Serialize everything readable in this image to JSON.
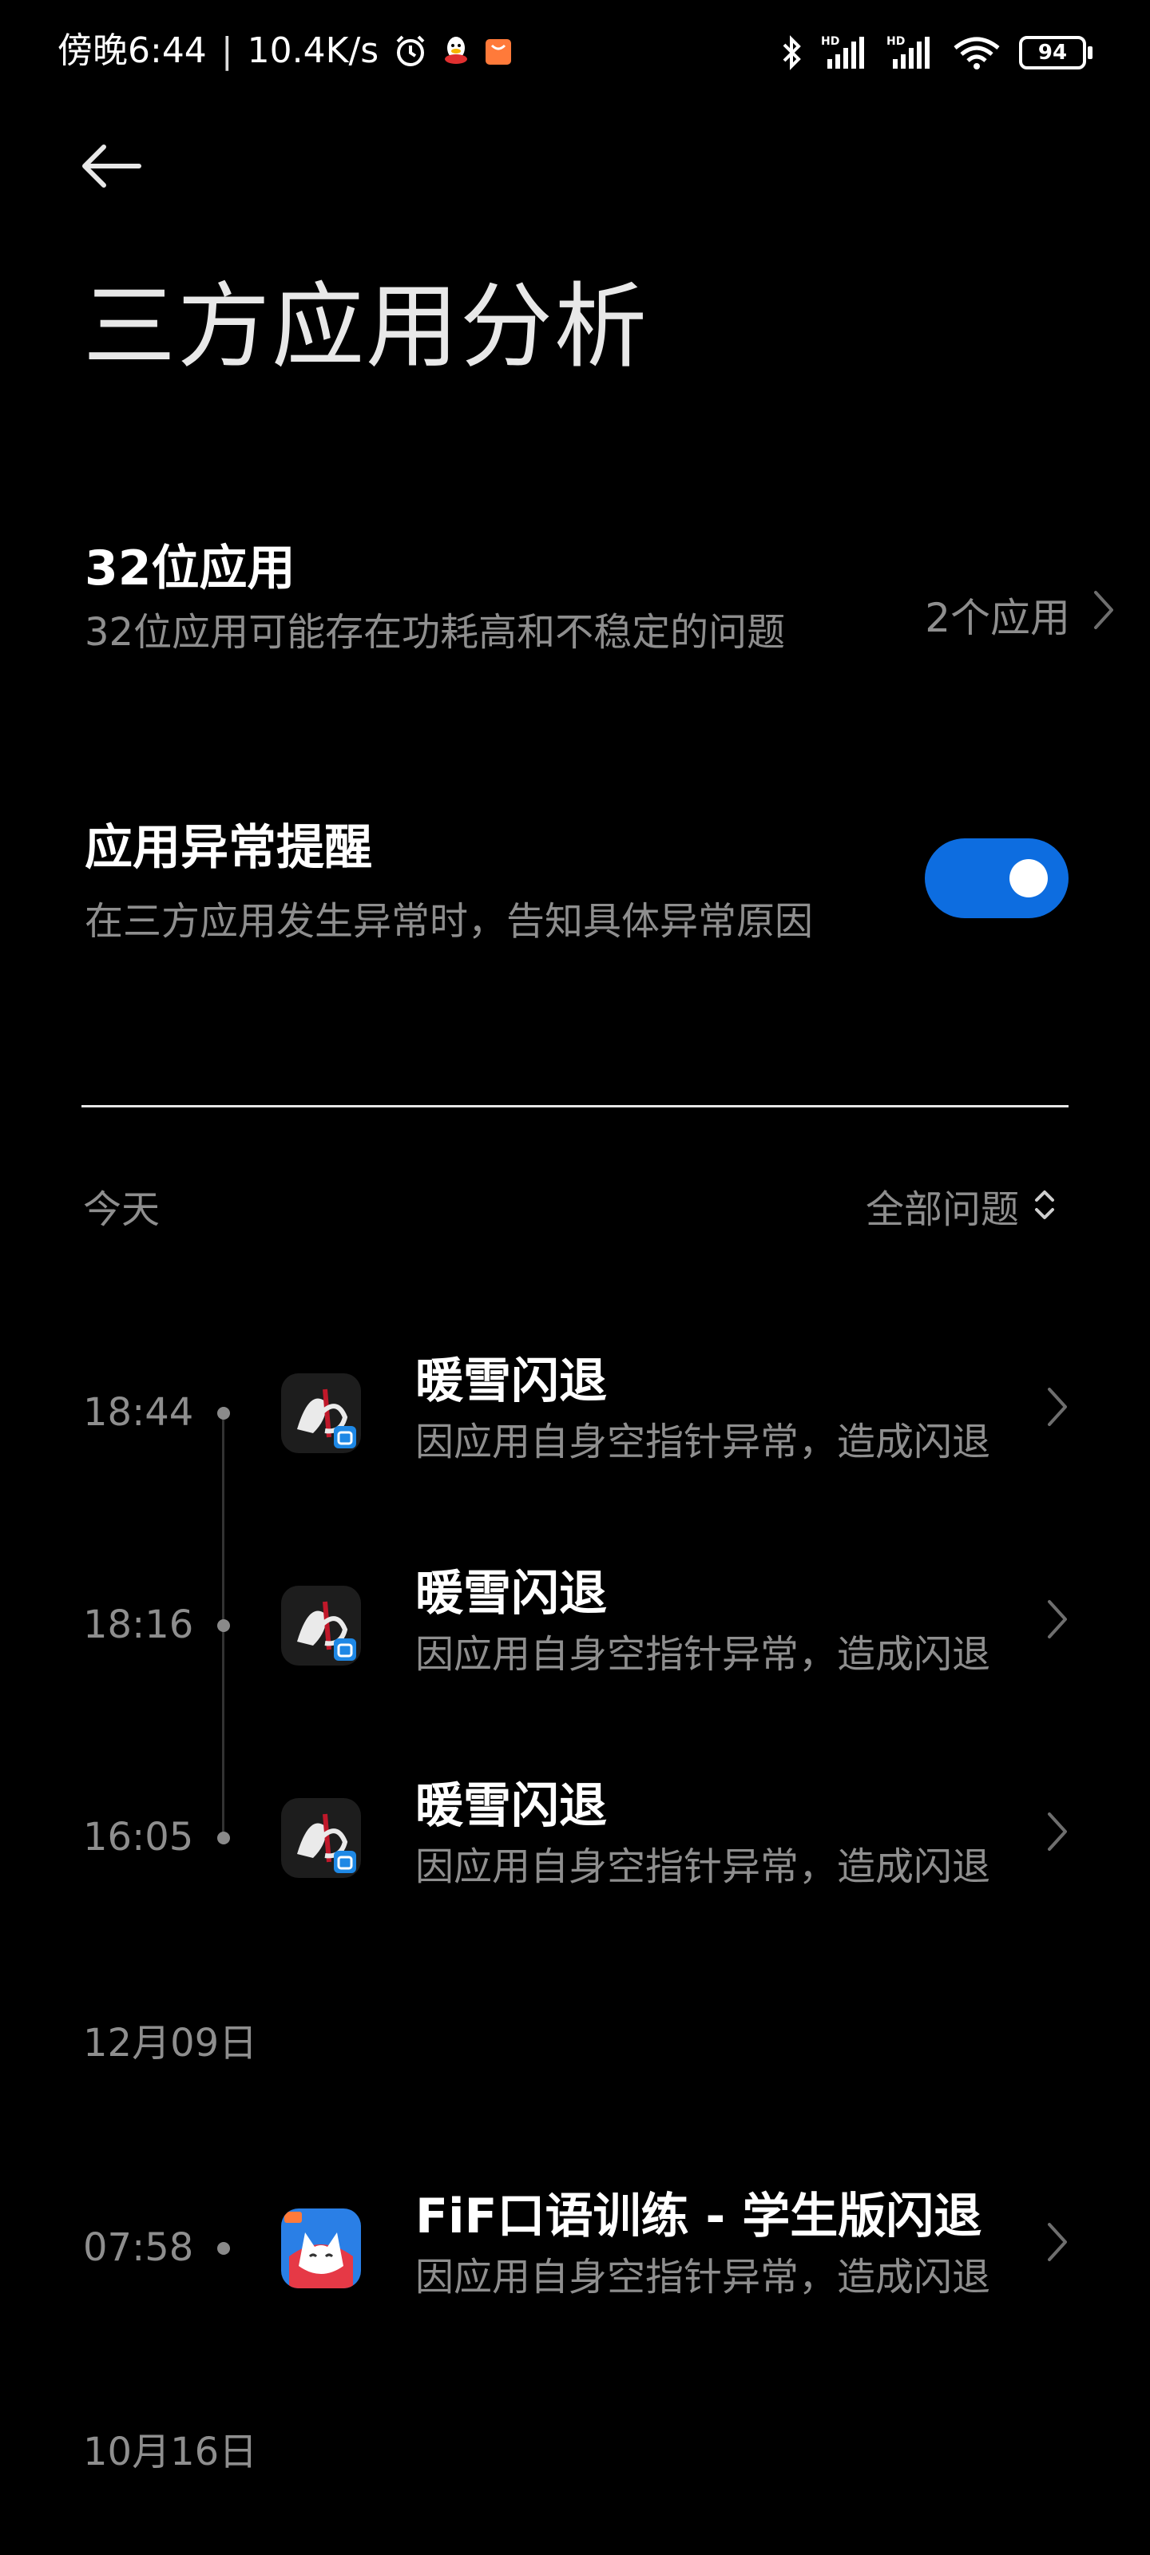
{
  "status_bar": {
    "time": "傍晚6:44",
    "separator": "|",
    "speed": "10.4K/s",
    "icons": [
      "alarm-icon",
      "qq-icon",
      "notification-icon",
      "bluetooth-icon",
      "signal-hd-icon",
      "signal-hd-icon",
      "wifi-icon"
    ],
    "battery": "94"
  },
  "header": {
    "back_icon": "back-arrow-icon",
    "title": "三方应用分析"
  },
  "settings": {
    "bit32": {
      "title": "32位应用",
      "subtitle": "32位应用可能存在功耗高和不稳定的问题",
      "value": "2个应用"
    },
    "alert": {
      "title": "应用异常提醒",
      "subtitle": "在三方应用发生异常时，告知具体异常原因",
      "enabled": true
    }
  },
  "list": {
    "today_label": "今天",
    "filter_label": "全部问题",
    "events_today": [
      {
        "time": "18:44",
        "title": "暖雪闪退",
        "subtitle": "因应用自身空指针异常，造成闪退"
      },
      {
        "time": "18:16",
        "title": "暖雪闪退",
        "subtitle": "因应用自身空指针异常，造成闪退"
      },
      {
        "time": "16:05",
        "title": "暖雪闪退",
        "subtitle": "因应用自身空指针异常，造成闪退"
      }
    ],
    "date_1209": "12月09日",
    "events_1209": [
      {
        "time": "07:58",
        "title": "FiF口语训练 - 学生版闪退",
        "subtitle": "因应用自身空指针异常，造成闪退"
      }
    ],
    "date_1016": "10月16日"
  },
  "colors": {
    "background": "#000000",
    "accent": "#0d6de0",
    "secondary_text": "#8e8e8e"
  }
}
